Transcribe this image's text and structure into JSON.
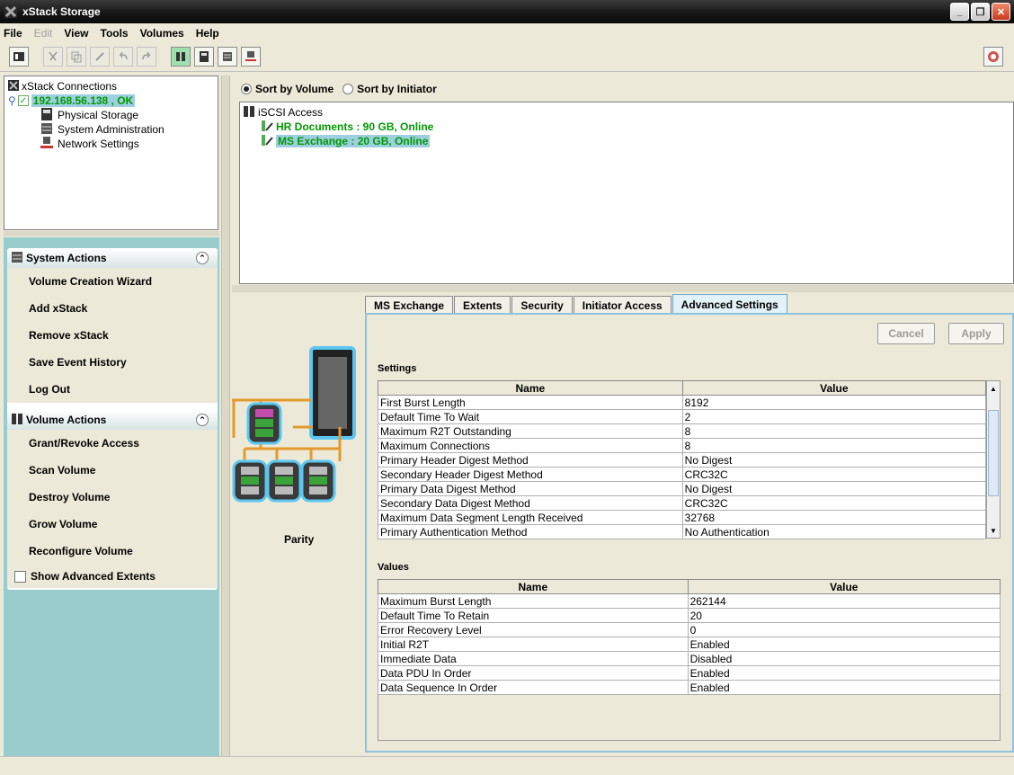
{
  "app": {
    "title": "xStack Storage"
  },
  "menu": [
    "File",
    "Edit",
    "View",
    "Tools",
    "Volumes",
    "Help"
  ],
  "tree": {
    "root": "xStack Connections",
    "host": "192.168.56.138 , OK",
    "children": [
      "Physical Storage",
      "System Administration",
      "Network Settings"
    ]
  },
  "sort": {
    "by_volume": "Sort by Volume",
    "by_initiator": "Sort by Initiator",
    "selected": "by_volume"
  },
  "volumes": {
    "root": "iSCSI Access",
    "items": [
      {
        "label": "HR Documents : 90 GB, Online"
      },
      {
        "label": "MS Exchange : 20 GB, Online"
      }
    ]
  },
  "system_actions": {
    "title": "System Actions",
    "items": [
      "Volume Creation Wizard",
      "Add xStack",
      "Remove xStack",
      "Save Event History",
      "Log Out"
    ]
  },
  "volume_actions": {
    "title": "Volume Actions",
    "items": [
      "Grant/Revoke Access",
      "Scan Volume",
      "Destroy Volume",
      "Grow Volume",
      "Reconfigure Volume"
    ],
    "checkbox": "Show Advanced Extents"
  },
  "raid_label": "Parity",
  "tabs": [
    "MS Exchange",
    "Extents",
    "Security",
    "Initiator Access",
    "Advanced Settings"
  ],
  "buttons": {
    "cancel": "Cancel",
    "apply": "Apply"
  },
  "settings": {
    "title": "Settings",
    "col_name": "Name",
    "col_value": "Value",
    "rows": [
      [
        "First Burst Length",
        "8192"
      ],
      [
        "Default Time To Wait",
        "2"
      ],
      [
        "Maximum R2T Outstanding",
        "8"
      ],
      [
        "Maximum Connections",
        "8"
      ],
      [
        "Primary Header Digest Method",
        "No Digest"
      ],
      [
        "Secondary Header Digest Method",
        "CRC32C"
      ],
      [
        "Primary Data Digest Method",
        "No Digest"
      ],
      [
        "Secondary Data Digest Method",
        "CRC32C"
      ],
      [
        "Maximum Data Segment Length Received",
        "32768"
      ],
      [
        "Primary Authentication Method",
        "No Authentication"
      ]
    ]
  },
  "values": {
    "title": "Values",
    "col_name": "Name",
    "col_value": "Value",
    "rows": [
      [
        "Maximum Burst Length",
        "262144"
      ],
      [
        "Default Time To Retain",
        "20"
      ],
      [
        "Error Recovery Level",
        "0"
      ],
      [
        "Initial R2T",
        "Enabled"
      ],
      [
        "Immediate Data",
        "Disabled"
      ],
      [
        "Data PDU In Order",
        "Enabled"
      ],
      [
        "Data Sequence In Order",
        "Enabled"
      ]
    ]
  },
  "colors": {
    "accent": "#99cdcd",
    "online_green": "#009a00",
    "tab_active": "#e3f1f8"
  }
}
